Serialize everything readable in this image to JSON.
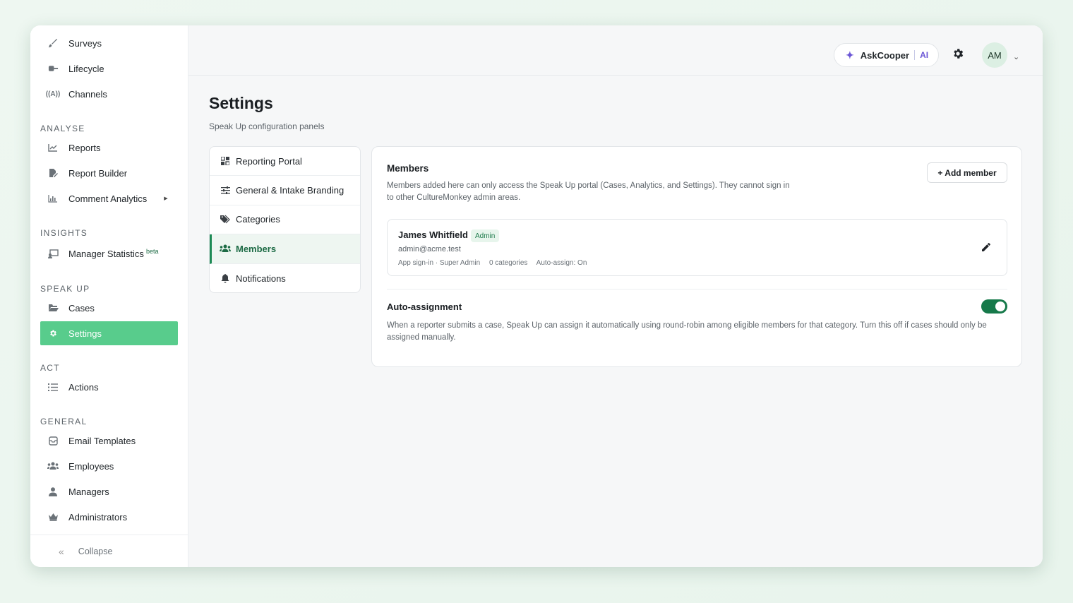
{
  "sidebar": {
    "top_items": [
      {
        "label": "Surveys",
        "icon": "brush-icon"
      },
      {
        "label": "Lifecycle",
        "icon": "lifecycle-icon"
      },
      {
        "label": "Channels",
        "icon": "broadcast-icon"
      }
    ],
    "sections": {
      "analyse": "ANALYSE",
      "insights": "INSIGHTS",
      "speak_up": "SPEAK UP",
      "act": "ACT",
      "general": "GENERAL"
    },
    "analyse_items": [
      {
        "label": "Reports"
      },
      {
        "label": "Report Builder"
      },
      {
        "label": "Comment Analytics"
      }
    ],
    "insights_items": [
      {
        "label": "Manager Statistics",
        "badge": "beta"
      }
    ],
    "speak_up_items": [
      {
        "label": "Cases"
      },
      {
        "label": "Settings",
        "active": true
      }
    ],
    "act_items": [
      {
        "label": "Actions"
      }
    ],
    "general_items": [
      {
        "label": "Email Templates"
      },
      {
        "label": "Employees"
      },
      {
        "label": "Managers"
      },
      {
        "label": "Administrators"
      }
    ],
    "collapse_label": "Collapse",
    "active_color": "#58cc8c"
  },
  "topbar": {
    "ask_label": "AskCooper",
    "ai_label": "AI",
    "avatar_initials": "AM"
  },
  "page": {
    "title": "Settings",
    "subtitle": "Speak Up configuration panels"
  },
  "panels": [
    {
      "label": "Reporting Portal",
      "icon": "grid-icon"
    },
    {
      "label": "General & Intake Branding",
      "icon": "sliders-icon"
    },
    {
      "label": "Categories",
      "icon": "tags-icon"
    },
    {
      "label": "Members",
      "icon": "users-icon",
      "active": true
    },
    {
      "label": "Notifications",
      "icon": "bell-icon"
    }
  ],
  "members_card": {
    "title": "Members",
    "description": "Members added here can only access the Speak Up portal (Cases, Analytics, and Settings). They cannot sign in to other CultureMonkey admin areas.",
    "add_button": "+ Add member",
    "members": [
      {
        "name": "James Whitfield",
        "role_badge": "Admin",
        "email": "admin@acme.test",
        "sign_in": "App sign-in · Super Admin",
        "categories": "0 categories",
        "auto_assign": "Auto-assign: On"
      }
    ],
    "auto_assignment": {
      "title": "Auto-assignment",
      "description": "When a reporter submits a case, Speak Up can assign it automatically using round-robin among eligible members for that category. Turn this off if cases should only be assigned manually.",
      "enabled": true
    },
    "accent_color": "#16794a"
  }
}
